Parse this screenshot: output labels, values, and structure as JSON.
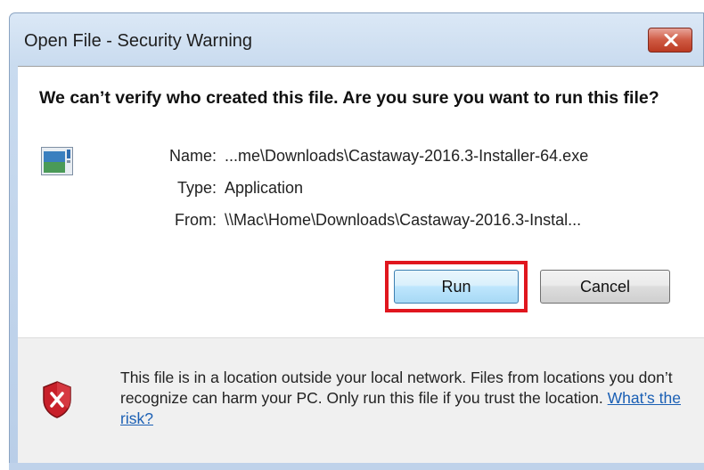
{
  "window": {
    "title": "Open File - Security Warning"
  },
  "headline": "We can’t verify who created this file. Are you sure you want to run this file?",
  "details": {
    "name_label": "Name:",
    "name_value": "...me\\Downloads\\Castaway-2016.3-Installer-64.exe",
    "type_label": "Type:",
    "type_value": "Application",
    "from_label": "From:",
    "from_value": "\\\\Mac\\Home\\Downloads\\Castaway-2016.3-Instal..."
  },
  "buttons": {
    "run_label": "Run",
    "cancel_label": "Cancel"
  },
  "warning": {
    "text": "This file is in a location outside your local network. Files from locations you don’t recognize can harm your PC. Only run this file if you trust the location. ",
    "link_text": "What’s the risk?"
  },
  "colors": {
    "highlight": "#e0161e",
    "link": "#1a5fb4",
    "close_button": "#c9503b"
  },
  "icons": [
    "close-icon",
    "application-file-icon",
    "shield-error-icon"
  ]
}
